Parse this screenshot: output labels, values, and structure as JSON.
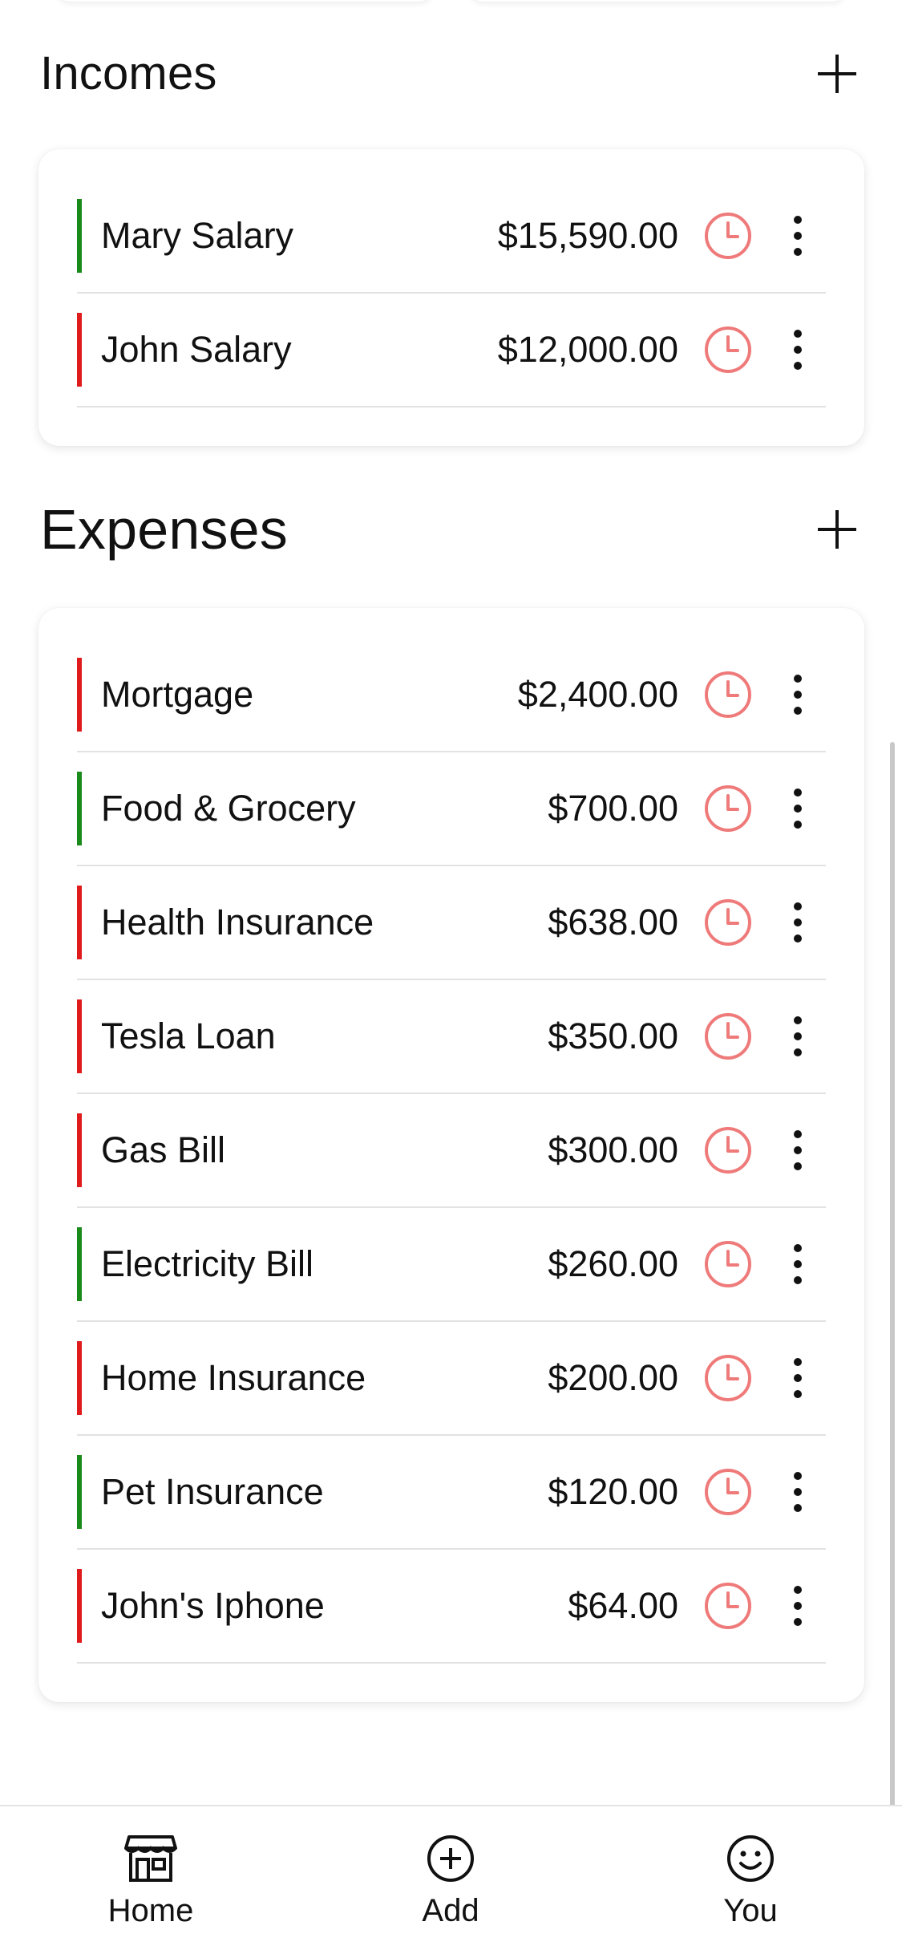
{
  "incomes": {
    "title": "Incomes",
    "items": [
      {
        "name": "Mary Salary",
        "amount": "$15,590.00",
        "bar_color": "green"
      },
      {
        "name": "John Salary",
        "amount": "$12,000.00",
        "bar_color": "red"
      }
    ]
  },
  "expenses": {
    "title": "Expenses",
    "items": [
      {
        "name": "Mortgage",
        "amount": "$2,400.00",
        "bar_color": "red"
      },
      {
        "name": "Food & Grocery",
        "amount": "$700.00",
        "bar_color": "green"
      },
      {
        "name": "Health Insurance",
        "amount": "$638.00",
        "bar_color": "red"
      },
      {
        "name": "Tesla Loan",
        "amount": "$350.00",
        "bar_color": "red"
      },
      {
        "name": "Gas Bill",
        "amount": "$300.00",
        "bar_color": "red"
      },
      {
        "name": "Electricity Bill",
        "amount": "$260.00",
        "bar_color": "green"
      },
      {
        "name": "Home Insurance",
        "amount": "$200.00",
        "bar_color": "red"
      },
      {
        "name": "Pet Insurance",
        "amount": "$120.00",
        "bar_color": "green"
      },
      {
        "name": "John's Iphone",
        "amount": "$64.00",
        "bar_color": "red"
      }
    ]
  },
  "icons": {
    "add": "plus-icon",
    "schedule": "clock-icon",
    "more": "kebab-menu-icon"
  },
  "colors": {
    "clock": "#ef7a7a",
    "bar_red": "#e01b1b",
    "bar_green": "#1a8a1a"
  },
  "nav": {
    "home": {
      "label": "Home",
      "icon": "store-icon"
    },
    "add": {
      "label": "Add",
      "icon": "plus-circle-icon"
    },
    "you": {
      "label": "You",
      "icon": "smiley-icon"
    }
  }
}
